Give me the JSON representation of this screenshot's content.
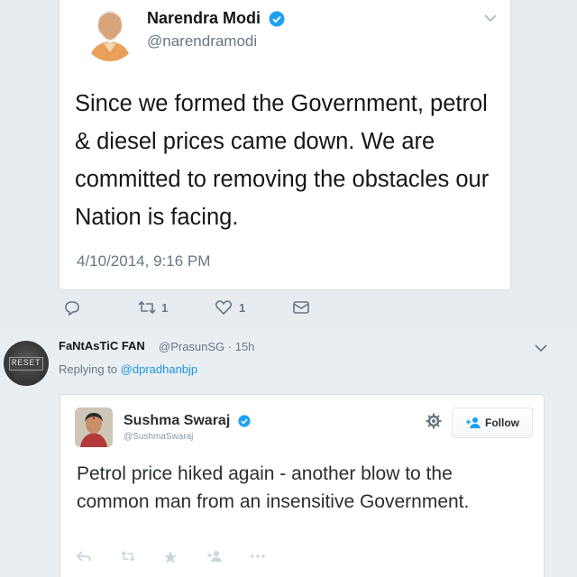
{
  "main_tweet": {
    "author_name": "Narendra Modi",
    "author_handle": "@narendramodi",
    "text": "Since we formed the Government, petrol & diesel prices came down. We are committed to removing the obstacles our Nation is facing.",
    "timestamp": "4/10/2014, 9:16 PM",
    "retweet_count": "1",
    "like_count": "1"
  },
  "reply": {
    "author_name": "FaNtAsTiC FAN",
    "author_handle": "@PrasunSG · 15h",
    "avatar_text": "RESET",
    "replying_prefix": "Replying to",
    "replying_to": "@dpradhanbjp"
  },
  "embedded_tweet": {
    "author_name": "Sushma Swaraj",
    "author_handle": "@SushmaSwaraj",
    "follow_label": "Follow",
    "text": "Petrol price hiked again - another blow to the common man from an insensitive Government."
  },
  "colors": {
    "verified": "#1da1f2",
    "link": "#1b95e0",
    "muted": "#657786"
  }
}
